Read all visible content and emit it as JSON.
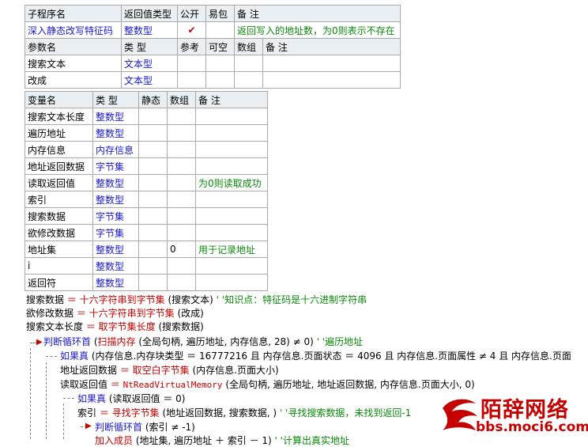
{
  "sub_table": {
    "headers": [
      "子程序名",
      "返回值类型",
      "公开",
      "易包",
      "备 注"
    ],
    "row": {
      "name": "深入静态改写特征码",
      "return_type": "整数型",
      "public_mark": "✔",
      "ebag": "",
      "remark": "返回写入的地址数，为0则表示不存在"
    },
    "param_headers": [
      "参数名",
      "类 型",
      "参考",
      "可空",
      "数组",
      "备 注"
    ],
    "params": [
      {
        "name": "搜索文本",
        "type": "文本型"
      },
      {
        "name": "改成",
        "type": "文本型"
      }
    ]
  },
  "var_table": {
    "headers": [
      "变量名",
      "类 型",
      "静态",
      "数组",
      "备 注"
    ],
    "rows": [
      {
        "name": "搜索文本长度",
        "type": "整数型",
        "static": "",
        "array": "",
        "remark": ""
      },
      {
        "name": "遍历地址",
        "type": "整数型",
        "static": "",
        "array": "",
        "remark": ""
      },
      {
        "name": "内存信息",
        "type": "内存信息",
        "static": "",
        "array": "",
        "remark": ""
      },
      {
        "name": "地址返回数据",
        "type": "字节集",
        "static": "",
        "array": "",
        "remark": ""
      },
      {
        "name": "读取返回值",
        "type": "整数型",
        "static": "",
        "array": "",
        "remark": "为0则读取成功"
      },
      {
        "name": "索引",
        "type": "整数型",
        "static": "",
        "array": "",
        "remark": ""
      },
      {
        "name": "搜索数据",
        "type": "字节集",
        "static": "",
        "array": "",
        "remark": ""
      },
      {
        "name": "欲修改数据",
        "type": "字节集",
        "static": "",
        "array": "",
        "remark": ""
      },
      {
        "name": "地址集",
        "type": "整数型",
        "static": "",
        "array": "0",
        "remark": "用于记录地址"
      },
      {
        "name": "i",
        "type": "整数型",
        "static": "",
        "array": "",
        "remark": ""
      },
      {
        "name": "返回符",
        "type": "整数型",
        "static": "",
        "array": "",
        "remark": ""
      }
    ]
  },
  "code": {
    "line1": {
      "a": "搜索数据",
      "b": " ＝ ",
      "c": "十六字符串到字节集",
      "d": " (搜索文本) ",
      "e": "' '知识点：特征码是十六进制字符串"
    },
    "line2": {
      "a": "欲修改数据",
      "b": " ＝ ",
      "c": "十六字符串到字节集",
      "d": " (改成)"
    },
    "line3": {
      "a": "搜索文本长度",
      "b": " ＝ ",
      "c": "取字节集长度",
      "d": " (搜索数据)"
    },
    "line4": {
      "a": "判断循环首",
      "b": " (",
      "c": "扫描内存",
      "d": " (全局句柄, 遍历地址, 内存信息, 28) ≠ 0) ",
      "e": "' '遍历地址"
    },
    "line5": {
      "a": "如果真",
      "b": " (内存信息.内存块类型 ＝ 16777216 且 内存信息.页面状态 ＝ 4096 且 内存信息.页面属性 ≠ 4 且 内存信息.页面"
    },
    "line6": {
      "a": "地址返回数据",
      "b": " ＝ ",
      "c": "取空白字节集",
      "d": " (内存信息.页面大小)"
    },
    "line7": {
      "a": "读取返回值",
      "b": " ＝ ",
      "c": "NtReadVirtualMemory",
      "d": " (全局句柄, 遍历地址, 地址返回数据, 内存信息.页面大小, 0)"
    },
    "line8": {
      "a": "如果真",
      "b": " (读取返回值 ＝ 0)"
    },
    "line9": {
      "a": "索引",
      "b": " ＝ ",
      "c": "寻找字节集",
      "d": " (地址返回数据, 搜索数据, ) ",
      "e": "' '寻找搜索数据，未找到返回-1"
    },
    "line10": {
      "a": "判断循环首",
      "b": " (索引 ≠ -1)"
    },
    "line11": {
      "a": "加入成员",
      "b": " (地址集, 遍历地址 ＋ 索引 － 1) ",
      "e": "' '计算出真实地址"
    }
  },
  "watermark": {
    "title": "陌辞网络",
    "url": "bbs.moci6.com"
  },
  "colors": {
    "header_bg": "#e9eff3",
    "type_blue": "#1a1acd",
    "comment_green": "#0a8a0a",
    "keyword_red": "#c40000",
    "grid": "#a9a9a9"
  }
}
